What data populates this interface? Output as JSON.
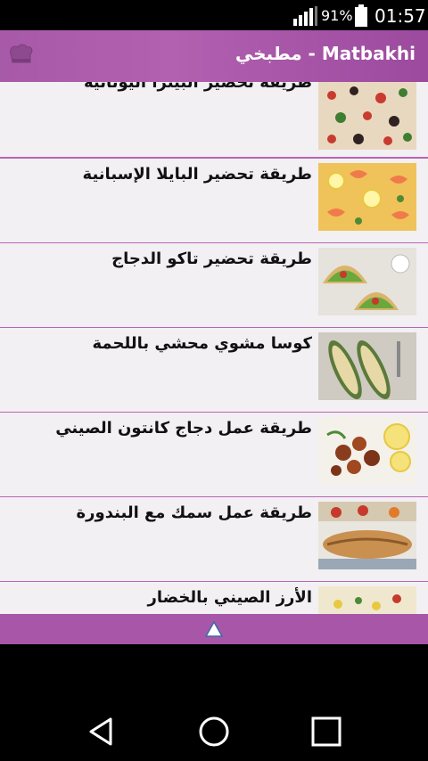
{
  "status_bar": {
    "battery_percent": "91%",
    "time": "01:57",
    "icons": [
      "signal-icon",
      "battery-icon"
    ]
  },
  "app_bar": {
    "title": "مطبخي - Matbakhi",
    "icon": "chef-hat-icon"
  },
  "recipes": [
    {
      "title": "طريقة تحضير البيتزا اليونانية",
      "thumb": "pizza"
    },
    {
      "title": "طريقة تحضير البايلا الإسبانية",
      "thumb": "paella"
    },
    {
      "title": "طريقة تحضير تاكو الدجاج",
      "thumb": "taco"
    },
    {
      "title": "كوسا مشوي محشي باللحمة",
      "thumb": "zucchini"
    },
    {
      "title": "طريقة عمل دجاج كانتون الصيني",
      "thumb": "chicken"
    },
    {
      "title": "طريقة عمل سمك مع البندورة",
      "thumb": "fish"
    },
    {
      "title": "الأرز الصيني بالخضار",
      "thumb": "rice"
    }
  ],
  "bottom_bar": {
    "icon": "scroll-up-icon"
  },
  "nav_bar": {
    "buttons": [
      "back-icon",
      "home-icon",
      "recents-icon"
    ]
  },
  "colors": {
    "accent": "#a857a8",
    "divider": "#b765b5",
    "list_bg": "#f2f0f2"
  }
}
